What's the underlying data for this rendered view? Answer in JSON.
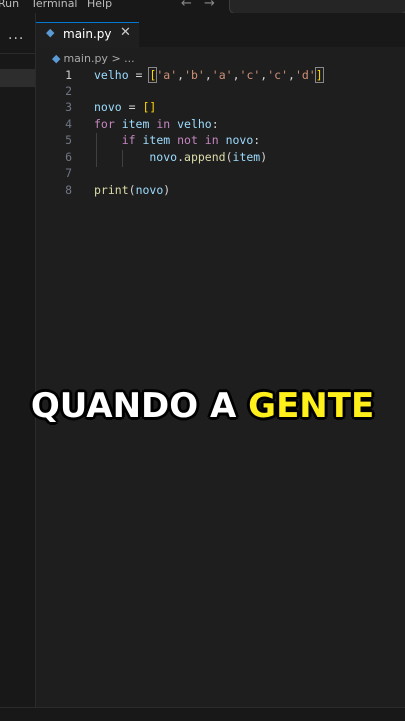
{
  "menubar": {
    "items": [
      "Run",
      "Terminal",
      "Help"
    ],
    "back_arrow": "←",
    "forward_arrow": "→"
  },
  "sidebar": {
    "more_icon": "..."
  },
  "tab": {
    "label": "main.py",
    "icon": "python-file-icon",
    "close": "✕"
  },
  "breadcrumb": {
    "file": "main.py",
    "sep": ">",
    "more": "..."
  },
  "editor": {
    "lines": [
      {
        "num": "1",
        "text": "velho = ['a','b','a','c','c','d']"
      },
      {
        "num": "2",
        "text": ""
      },
      {
        "num": "3",
        "text": "novo = []"
      },
      {
        "num": "4",
        "text": "for item in velho:"
      },
      {
        "num": "5",
        "text": "    if item not in novo:"
      },
      {
        "num": "6",
        "text": "        novo.append(item)"
      },
      {
        "num": "7",
        "text": ""
      },
      {
        "num": "8",
        "text": "print(novo)"
      }
    ]
  },
  "caption": {
    "part1": "QUANDO A ",
    "part2": "GENTE"
  },
  "colors": {
    "keyword": "#c586c0",
    "variable": "#9cdcfe",
    "string": "#ce9178",
    "function": "#dcdcaa",
    "caption_highlight": "#ffef1a"
  }
}
